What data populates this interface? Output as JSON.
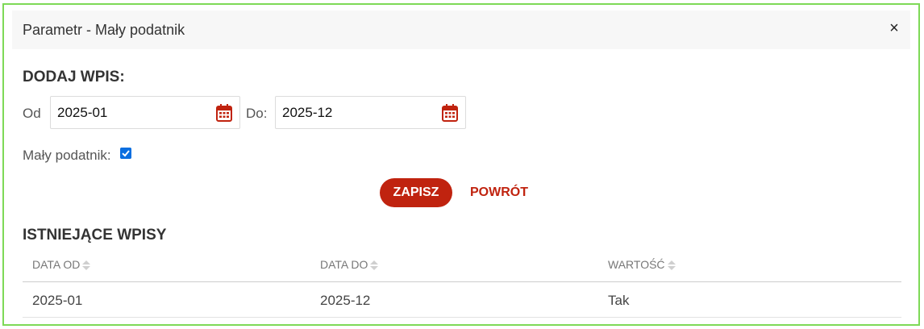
{
  "dialog": {
    "title": "Parametr - Mały podatnik",
    "close_glyph": "×"
  },
  "add_section": {
    "title": "DODAJ WPIS:",
    "from_label": "Od",
    "from_value": "2025-01",
    "to_label": "Do:",
    "to_value": "2025-12",
    "checkbox_label": "Mały podatnik:",
    "checkbox_checked": true,
    "save_label": "ZAPISZ",
    "back_label": "POWRÓT"
  },
  "existing_section": {
    "title": "ISTNIEJĄCE WPISY",
    "columns": [
      "DATA OD",
      "DATA DO",
      "WARTOŚĆ"
    ],
    "rows": [
      [
        "2025-01",
        "2025-12",
        "Tak"
      ]
    ]
  },
  "colors": {
    "accent": "#c0230f",
    "checkbox": "#0b6fe0",
    "dialog_border": "#7ed957"
  },
  "icons": {
    "date_picker": "calendar-icon",
    "sort": "sort-icon",
    "close": "close-icon"
  }
}
